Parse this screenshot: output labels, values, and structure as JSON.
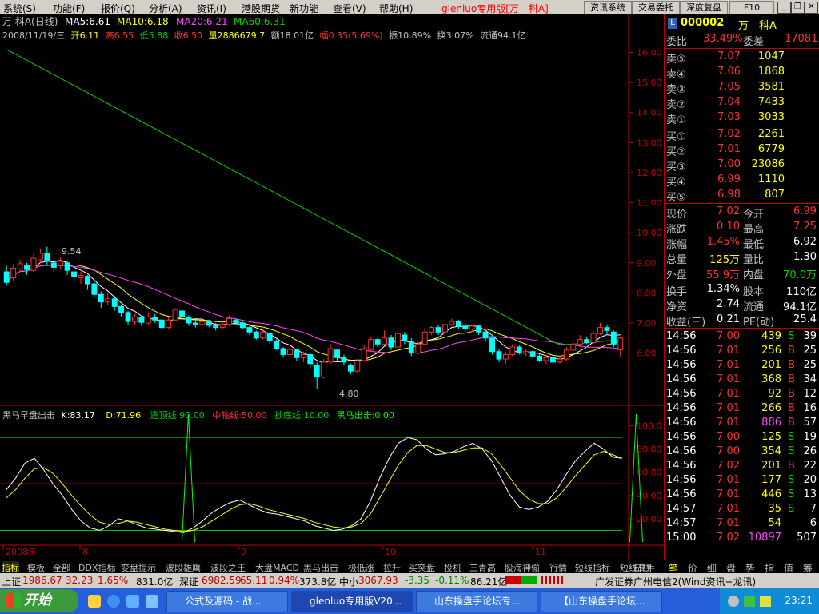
{
  "menu": {
    "items": [
      "系统(S)",
      "功能(F)",
      "报价(Q)",
      "分析(A)",
      "资讯(I)",
      "港股期货",
      "新功能",
      "查看(V)",
      "帮助(H)"
    ],
    "title": "glenluo专用版[万　科A]",
    "buttons": [
      "资讯系统",
      "交易委托",
      "深度复盘",
      "F10"
    ]
  },
  "chart_header": {
    "stock_label": "万  科A(日线)",
    "ma5": "MA5:6.61",
    "ma10": "MA10:6.18",
    "ma20": "MA20:6.21",
    "ma60": "MA60:6.31",
    "bar_info": {
      "date": "2008/11/19/三",
      "open": "开6.11",
      "high": "高6.55",
      "low": "低5.88",
      "close": "收6.50",
      "vol": "量2886679.7",
      "amount": "额18.01亿",
      "change": "幅0.35(5.69%)",
      "amp": "振10.89%",
      "turnover": "换3.07%",
      "float": "流通94.1亿"
    },
    "hi_annot": "9.54",
    "lo_annot": "4.80"
  },
  "indicator_header": {
    "name": "黑马早盘出击",
    "k": "K:83.17",
    "d": "D:71.96",
    "escape": "逃顶线:90.00",
    "mid": "中轴线:50.00",
    "bottom": "抄底线:10.00",
    "signal": "黑马出击:0.00"
  },
  "colors": {
    "up": "#ff3030",
    "down": "#00ffff",
    "ma5": "#ffffff",
    "ma10": "#ffff00",
    "ma20": "#ff44ff",
    "ma60": "#00d000",
    "axis": "#c00000",
    "k": "#ffffff",
    "d": "#ffff00",
    "signal": "#00ff00"
  },
  "chart_data": [
    {
      "type": "candlestick",
      "title": "万  科A(日线)",
      "y_ticks": [
        "16.00",
        "15.00",
        "14.00",
        "13.00",
        "12.00",
        "11.00",
        "10.00",
        "9.00",
        "8.00",
        "7.00",
        "6.00"
      ],
      "ylim": [
        4.5,
        16.2
      ],
      "x_months": [
        "2008年",
        "8",
        "9",
        "10",
        "11"
      ],
      "candles": [
        {
          "o": 8.7,
          "c": 8.35,
          "h": 8.9,
          "l": 8.25
        },
        {
          "o": 8.5,
          "c": 8.82,
          "h": 8.95,
          "l": 8.4
        },
        {
          "o": 8.8,
          "c": 8.97,
          "h": 9.1,
          "l": 8.7
        },
        {
          "o": 8.9,
          "c": 8.78,
          "h": 9.0,
          "l": 8.6
        },
        {
          "o": 8.75,
          "c": 9.15,
          "h": 9.3,
          "l": 8.7
        },
        {
          "o": 9.1,
          "c": 9.32,
          "h": 9.45,
          "l": 9.0
        },
        {
          "o": 9.3,
          "c": 9.05,
          "h": 9.54,
          "l": 8.9
        },
        {
          "o": 9.0,
          "c": 8.85,
          "h": 9.1,
          "l": 8.7
        },
        {
          "o": 8.9,
          "c": 9.05,
          "h": 9.2,
          "l": 8.8
        },
        {
          "o": 9.0,
          "c": 8.75,
          "h": 9.05,
          "l": 8.6
        },
        {
          "o": 8.7,
          "c": 8.55,
          "h": 8.8,
          "l": 8.3
        },
        {
          "o": 8.5,
          "c": 8.58,
          "h": 8.7,
          "l": 8.3
        },
        {
          "o": 8.55,
          "c": 8.3,
          "h": 8.6,
          "l": 8.1
        },
        {
          "o": 8.3,
          "c": 7.95,
          "h": 8.35,
          "l": 7.85
        },
        {
          "o": 7.95,
          "c": 7.7,
          "h": 8.05,
          "l": 7.5
        },
        {
          "o": 7.7,
          "c": 7.8,
          "h": 8.0,
          "l": 7.6
        },
        {
          "o": 7.8,
          "c": 7.55,
          "h": 7.9,
          "l": 7.4
        },
        {
          "o": 7.55,
          "c": 7.35,
          "h": 7.6,
          "l": 7.2
        },
        {
          "o": 7.35,
          "c": 7.05,
          "h": 7.4,
          "l": 6.95
        },
        {
          "o": 7.05,
          "c": 7.2,
          "h": 7.3,
          "l": 6.95
        },
        {
          "o": 7.2,
          "c": 7.02,
          "h": 7.25,
          "l": 6.9
        },
        {
          "o": 7.0,
          "c": 7.2,
          "h": 7.35,
          "l": 6.95
        },
        {
          "o": 7.2,
          "c": 7.1,
          "h": 7.3,
          "l": 7.0
        },
        {
          "o": 7.1,
          "c": 6.85,
          "h": 7.15,
          "l": 6.8
        },
        {
          "o": 6.85,
          "c": 7.1,
          "h": 7.2,
          "l": 6.8
        },
        {
          "o": 7.1,
          "c": 7.45,
          "h": 7.5,
          "l": 7.05
        },
        {
          "o": 7.4,
          "c": 7.2,
          "h": 7.5,
          "l": 7.1
        },
        {
          "o": 7.2,
          "c": 7.0,
          "h": 7.25,
          "l": 6.9
        },
        {
          "o": 7.0,
          "c": 6.95,
          "h": 7.1,
          "l": 6.85
        },
        {
          "o": 6.95,
          "c": 7.05,
          "h": 7.15,
          "l": 6.9
        },
        {
          "o": 7.05,
          "c": 6.92,
          "h": 7.1,
          "l": 6.85
        },
        {
          "o": 6.92,
          "c": 6.85,
          "h": 7.0,
          "l": 6.75
        },
        {
          "o": 6.85,
          "c": 6.95,
          "h": 7.05,
          "l": 6.8
        },
        {
          "o": 6.95,
          "c": 7.15,
          "h": 7.25,
          "l": 6.9
        },
        {
          "o": 7.1,
          "c": 7.0,
          "h": 7.15,
          "l": 6.95
        },
        {
          "o": 7.0,
          "c": 6.85,
          "h": 7.05,
          "l": 6.8
        },
        {
          "o": 6.85,
          "c": 6.7,
          "h": 6.9,
          "l": 6.6
        },
        {
          "o": 6.7,
          "c": 6.5,
          "h": 6.75,
          "l": 6.45
        },
        {
          "o": 6.5,
          "c": 6.7,
          "h": 6.8,
          "l": 6.45
        },
        {
          "o": 6.65,
          "c": 6.4,
          "h": 6.7,
          "l": 6.3
        },
        {
          "o": 6.4,
          "c": 6.15,
          "h": 6.45,
          "l": 6.1
        },
        {
          "o": 6.15,
          "c": 5.95,
          "h": 6.2,
          "l": 5.85
        },
        {
          "o": 5.95,
          "c": 6.12,
          "h": 6.2,
          "l": 5.9
        },
        {
          "o": 6.1,
          "c": 5.85,
          "h": 6.15,
          "l": 5.75
        },
        {
          "o": 5.85,
          "c": 5.95,
          "h": 6.05,
          "l": 5.7
        },
        {
          "o": 5.95,
          "c": 5.65,
          "h": 6.0,
          "l": 5.5
        },
        {
          "o": 5.6,
          "c": 5.2,
          "h": 5.7,
          "l": 4.8
        },
        {
          "o": 5.2,
          "c": 5.7,
          "h": 5.8,
          "l": 5.15
        },
        {
          "o": 5.7,
          "c": 6.15,
          "h": 6.3,
          "l": 5.65
        },
        {
          "o": 6.1,
          "c": 5.85,
          "h": 6.15,
          "l": 5.75
        },
        {
          "o": 5.85,
          "c": 5.7,
          "h": 5.95,
          "l": 5.6
        },
        {
          "o": 5.6,
          "c": 5.4,
          "h": 5.65,
          "l": 5.3
        },
        {
          "o": 5.4,
          "c": 5.75,
          "h": 5.8,
          "l": 5.35
        },
        {
          "o": 5.75,
          "c": 6.15,
          "h": 6.25,
          "l": 5.7
        },
        {
          "o": 6.1,
          "c": 6.45,
          "h": 6.55,
          "l": 6.05
        },
        {
          "o": 6.45,
          "c": 6.3,
          "h": 6.5,
          "l": 6.2
        },
        {
          "o": 6.3,
          "c": 6.5,
          "h": 6.75,
          "l": 6.25
        },
        {
          "o": 6.5,
          "c": 6.2,
          "h": 6.6,
          "l": 6.1
        },
        {
          "o": 6.2,
          "c": 6.65,
          "h": 6.85,
          "l": 6.15
        },
        {
          "o": 6.6,
          "c": 6.4,
          "h": 6.7,
          "l": 6.3
        },
        {
          "o": 6.4,
          "c": 6.0,
          "h": 6.5,
          "l": 5.9
        },
        {
          "o": 6.0,
          "c": 6.3,
          "h": 6.4,
          "l": 5.95
        },
        {
          "o": 6.3,
          "c": 6.7,
          "h": 6.85,
          "l": 6.25
        },
        {
          "o": 6.7,
          "c": 6.85,
          "h": 6.9,
          "l": 6.6
        },
        {
          "o": 6.85,
          "c": 6.7,
          "h": 6.95,
          "l": 6.6
        },
        {
          "o": 6.7,
          "c": 6.95,
          "h": 7.05,
          "l": 6.65
        },
        {
          "o": 6.95,
          "c": 7.05,
          "h": 7.15,
          "l": 6.9
        },
        {
          "o": 7.05,
          "c": 6.9,
          "h": 7.1,
          "l": 6.8
        },
        {
          "o": 6.9,
          "c": 6.8,
          "h": 7.0,
          "l": 6.7
        },
        {
          "o": 6.8,
          "c": 6.9,
          "h": 6.95,
          "l": 6.7
        },
        {
          "o": 6.9,
          "c": 6.7,
          "h": 6.95,
          "l": 6.6
        },
        {
          "o": 6.7,
          "c": 6.5,
          "h": 6.75,
          "l": 6.4
        },
        {
          "o": 6.5,
          "c": 6.05,
          "h": 6.55,
          "l": 5.95
        },
        {
          "o": 6.05,
          "c": 5.8,
          "h": 6.15,
          "l": 5.7
        },
        {
          "o": 5.8,
          "c": 5.95,
          "h": 6.05,
          "l": 5.65
        },
        {
          "o": 5.95,
          "c": 6.2,
          "h": 6.3,
          "l": 5.9
        },
        {
          "o": 6.2,
          "c": 6.0,
          "h": 6.25,
          "l": 5.95
        },
        {
          "o": 6.0,
          "c": 6.05,
          "h": 6.15,
          "l": 5.9
        },
        {
          "o": 6.05,
          "c": 5.9,
          "h": 6.1,
          "l": 5.85
        },
        {
          "o": 5.9,
          "c": 5.75,
          "h": 5.95,
          "l": 5.7
        },
        {
          "o": 5.75,
          "c": 5.85,
          "h": 5.95,
          "l": 5.65
        },
        {
          "o": 5.85,
          "c": 5.7,
          "h": 5.9,
          "l": 5.6
        },
        {
          "o": 5.7,
          "c": 5.8,
          "h": 5.9,
          "l": 5.65
        },
        {
          "o": 5.8,
          "c": 6.1,
          "h": 6.2,
          "l": 5.75
        },
        {
          "o": 6.1,
          "c": 6.3,
          "h": 6.45,
          "l": 6.05
        },
        {
          "o": 6.3,
          "c": 6.45,
          "h": 6.6,
          "l": 6.2
        },
        {
          "o": 6.45,
          "c": 6.35,
          "h": 6.55,
          "l": 6.3
        },
        {
          "o": 6.35,
          "c": 6.65,
          "h": 6.75,
          "l": 6.3
        },
        {
          "o": 6.65,
          "c": 6.85,
          "h": 7.0,
          "l": 6.6
        },
        {
          "o": 6.85,
          "c": 6.75,
          "h": 6.95,
          "l": 6.6
        },
        {
          "o": 6.7,
          "c": 6.3,
          "h": 6.75,
          "l": 6.2
        },
        {
          "o": 6.11,
          "c": 6.5,
          "h": 6.55,
          "l": 5.88
        }
      ]
    },
    {
      "type": "line",
      "title": "黑马早盘出击",
      "y_ticks": [
        "100.0",
        "80.00",
        "60.00",
        "40.00",
        "20.00"
      ],
      "ylim": [
        0,
        110
      ],
      "hlines": [
        90,
        50,
        10
      ],
      "series": [
        {
          "name": "K",
          "values": [
            45,
            55,
            68,
            72,
            62,
            50,
            40,
            28,
            18,
            12,
            10,
            14,
            20,
            18,
            15,
            12,
            11,
            10,
            9,
            8,
            12,
            18,
            25,
            30,
            34,
            36,
            32,
            28,
            25,
            24,
            22,
            20,
            18,
            14,
            12,
            10,
            11,
            14,
            20,
            35,
            55,
            72,
            85,
            90,
            88,
            80,
            75,
            76,
            78,
            82,
            85,
            80,
            70,
            55,
            40,
            30,
            28,
            30,
            35,
            45,
            58,
            70,
            78,
            85,
            80,
            73,
            72
          ]
        },
        {
          "name": "D",
          "values": [
            38,
            45,
            55,
            63,
            64,
            59,
            50,
            40,
            31,
            23,
            17,
            15,
            16,
            18,
            17,
            15,
            13,
            11,
            10,
            9,
            10,
            13,
            18,
            23,
            28,
            32,
            33,
            31,
            28,
            26,
            24,
            22,
            20,
            17,
            15,
            13,
            12,
            13,
            16,
            24,
            38,
            52,
            66,
            77,
            83,
            83,
            80,
            77,
            77,
            79,
            81,
            81,
            76,
            66,
            55,
            44,
            37,
            33,
            33,
            38,
            47,
            57,
            66,
            75,
            78,
            75,
            72
          ]
        },
        {
          "name": "黑马出击",
          "spikes": [
            13,
            45
          ]
        }
      ]
    }
  ],
  "orderbook": {
    "code": "000002",
    "name": "万　科A",
    "weibi_label": "委比",
    "weibi": "33.49%",
    "weicha_label": "委差",
    "weicha": "17081",
    "asks": [
      {
        "label": "卖⑤",
        "price": "7.07",
        "vol": "1047"
      },
      {
        "label": "卖④",
        "price": "7.06",
        "vol": "1868"
      },
      {
        "label": "卖③",
        "price": "7.05",
        "vol": "3581"
      },
      {
        "label": "卖②",
        "price": "7.04",
        "vol": "7433"
      },
      {
        "label": "卖①",
        "price": "7.03",
        "vol": "3033"
      }
    ],
    "bids": [
      {
        "label": "买①",
        "price": "7.02",
        "vol": "2261"
      },
      {
        "label": "买②",
        "price": "7.01",
        "vol": "6779"
      },
      {
        "label": "买③",
        "price": "7.00",
        "vol": "23086"
      },
      {
        "label": "买④",
        "price": "6.99",
        "vol": "1110"
      },
      {
        "label": "买⑤",
        "price": "6.98",
        "vol": "807"
      }
    ]
  },
  "quote": [
    {
      "l1": "现价",
      "v1": "7.02",
      "l2": "今开",
      "v2": "6.99"
    },
    {
      "l1": "涨跌",
      "v1": "0.10",
      "l2": "最高",
      "v2": "7.25"
    },
    {
      "l1": "涨幅",
      "v1": "1.45%",
      "l2": "最低",
      "v2": "6.92"
    },
    {
      "l1": "总量",
      "v1": "125万",
      "l2": "量比",
      "v2": "1.30"
    },
    {
      "l1": "外盘",
      "v1": "55.9万",
      "l2": "内盘",
      "v2": "70.0万"
    }
  ],
  "fundamentals": [
    {
      "l1": "换手",
      "v1": "1.34%",
      "l2": "股本",
      "v2": "110亿"
    },
    {
      "l1": "净资",
      "v1": "2.74",
      "l2": "流通",
      "v2": "94.1亿"
    },
    {
      "l1": "收益(三)",
      "v1": "0.21",
      "l2": "PE(动)",
      "v2": "25.4"
    }
  ],
  "ticks": [
    {
      "t": "14:56",
      "p": "7.00",
      "v": "439",
      "s": "S",
      "n": "39"
    },
    {
      "t": "14:56",
      "p": "7.01",
      "v": "256",
      "s": "B",
      "n": "25"
    },
    {
      "t": "14:56",
      "p": "7.01",
      "v": "201",
      "s": "B",
      "n": "25"
    },
    {
      "t": "14:56",
      "p": "7.01",
      "v": "368",
      "s": "B",
      "n": "34"
    },
    {
      "t": "14:56",
      "p": "7.01",
      "v": "92",
      "s": "B",
      "n": "12"
    },
    {
      "t": "14:56",
      "p": "7.01",
      "v": "266",
      "s": "B",
      "n": "16"
    },
    {
      "t": "14:56",
      "p": "7.01",
      "v": "886",
      "s": "B",
      "n": "57"
    },
    {
      "t": "14:56",
      "p": "7.00",
      "v": "125",
      "s": "S",
      "n": "19"
    },
    {
      "t": "14:56",
      "p": "7.00",
      "v": "354",
      "s": "S",
      "n": "26"
    },
    {
      "t": "14:56",
      "p": "7.02",
      "v": "201",
      "s": "B",
      "n": "22"
    },
    {
      "t": "14:56",
      "p": "7.01",
      "v": "177",
      "s": "S",
      "n": "20"
    },
    {
      "t": "14:56",
      "p": "7.01",
      "v": "446",
      "s": "S",
      "n": "13"
    },
    {
      "t": "14:57",
      "p": "7.01",
      "v": "35",
      "s": "S",
      "n": "7"
    },
    {
      "t": "14:57",
      "p": "7.01",
      "v": "54",
      "s": "",
      "n": "6"
    },
    {
      "t": "15:00",
      "p": "7.02",
      "v": "10897",
      "s": "",
      "n": "507"
    }
  ],
  "bottom_tabs": [
    "指标",
    "模板",
    "全部",
    "DDX指标",
    "变盘提示",
    "波段雄鹰",
    "波段之王",
    "大盘MACD",
    "黑马出击",
    "极低涨",
    "拉升",
    "买突盘",
    "投机",
    "三青高",
    "股海神偷",
    "行情",
    "短线指标",
    "短线高手"
  ],
  "period_label": "日线",
  "right_tabs": [
    "笔",
    "价",
    "细",
    "盘",
    "势",
    "指",
    "值",
    "筹"
  ],
  "ticker": {
    "sh_label": "上证",
    "sh": "1986.67",
    "sh_chg": "32.23",
    "sh_pct": "1.65%",
    "sh_amt": "831.0亿",
    "sz_label": "深证",
    "sz": "6982.59",
    "sz_chg": "65.11",
    "sz_pct": "0.94%",
    "sz_amt": "373.8亿",
    "zx_label": "中小",
    "zx": "3067.93",
    "zx_chg": "-3.35",
    "zx_pct": "-0.11%",
    "zx_amt": "86.21亿",
    "broker": "广发证券广州电信2(Wind资讯+龙讯)"
  },
  "taskbar": {
    "start": "开始",
    "tasks": [
      "公式及源码 - 战...",
      "glenluo专用版V20...",
      "山东操盘手论坛专...",
      "【山东操盘手论坛..."
    ],
    "clock": "23:21"
  }
}
